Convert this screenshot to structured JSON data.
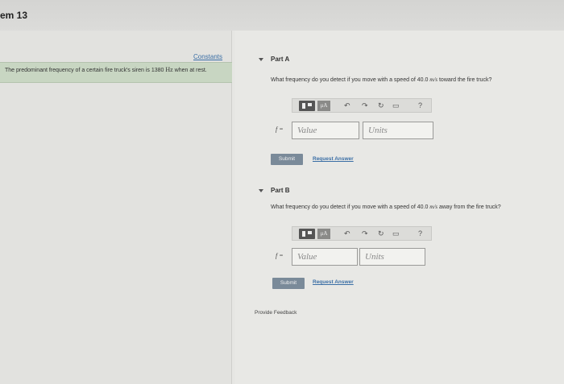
{
  "header": {
    "problem_title": "em 13"
  },
  "left": {
    "constants_label": "Constants",
    "intro_text": "The predominant frequency of a certain fire truck's siren is 1380",
    "intro_unit": "Hz",
    "intro_text_end": "when at rest."
  },
  "parts": [
    {
      "title": "Part A",
      "question_prefix": "What frequency do you detect if you move with a speed of 40.0",
      "question_unit": "m/s",
      "question_suffix": "toward the fire truck?",
      "toolbar": {
        "mu_label": "μA",
        "undo": "↶",
        "redo": "↷",
        "reset": "↻",
        "keyboard": "▭",
        "help": "?"
      },
      "variable": "f =",
      "value_placeholder": "Value",
      "units_placeholder": "Units",
      "submit_label": "Submit",
      "request_label": "Request Answer"
    },
    {
      "title": "Part B",
      "question_prefix": "What frequency do you detect if you move with a speed of 40.0",
      "question_unit": "m/s",
      "question_suffix": "away from the fire truck?",
      "toolbar": {
        "mu_label": "μA",
        "undo": "↶",
        "redo": "↷",
        "reset": "↻",
        "keyboard": "▭",
        "help": "?"
      },
      "variable": "f =",
      "value_placeholder": "Value",
      "units_placeholder": "Units",
      "submit_label": "Submit",
      "request_label": "Request Answer"
    }
  ],
  "feedback_label": "Provide Feedback"
}
